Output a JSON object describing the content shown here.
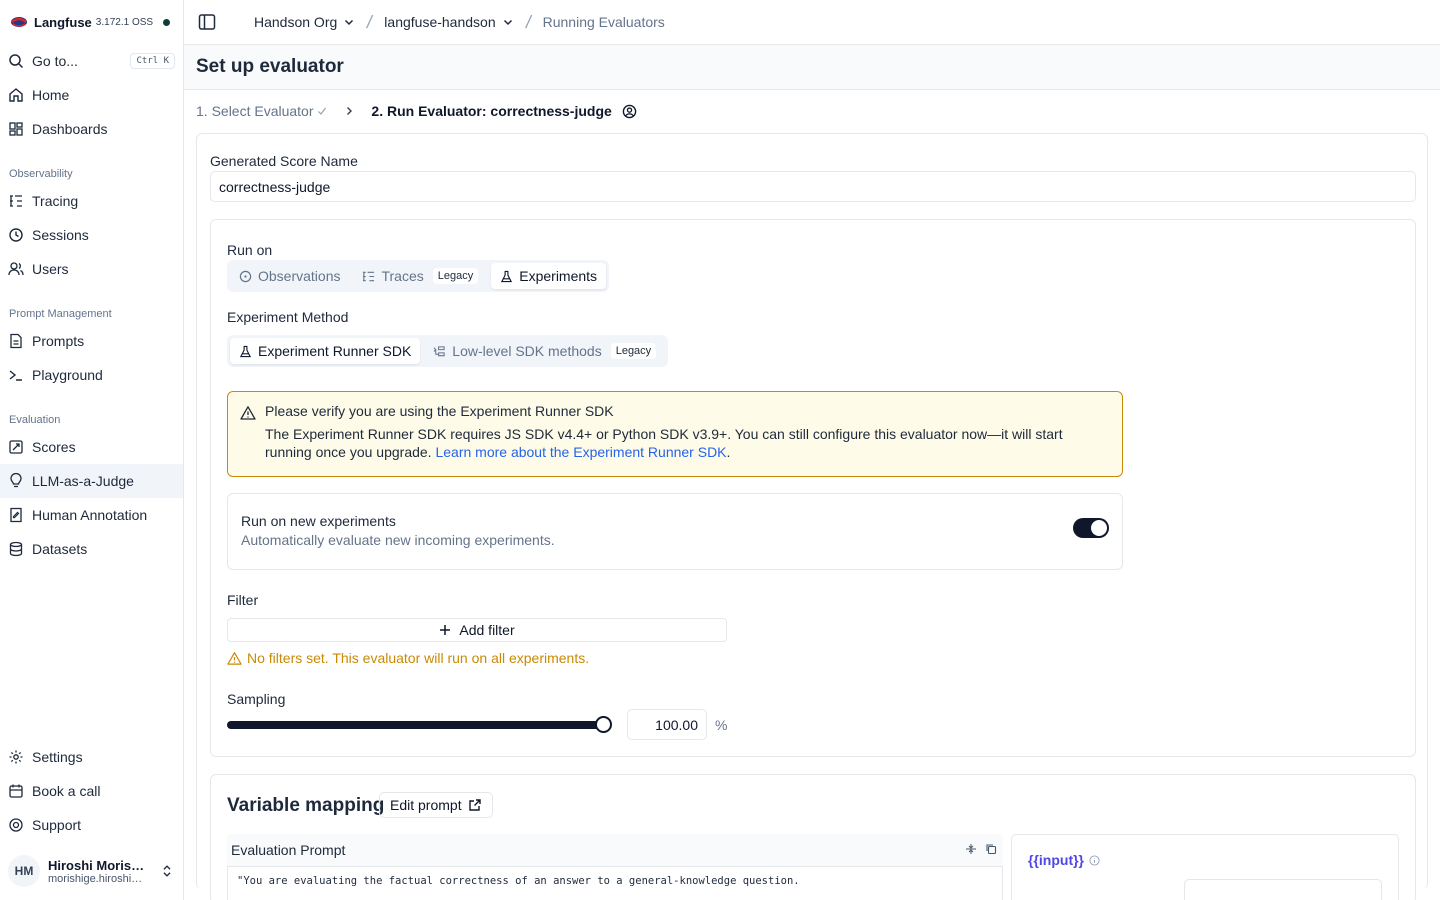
{
  "brand": {
    "name": "Langfuse",
    "version": "3.172.1 OSS"
  },
  "sidebar": {
    "goto_label": "Go to...",
    "goto_shortcut": "Ctrl K",
    "items_top": [
      {
        "label": "Home",
        "icon": "home-icon"
      },
      {
        "label": "Dashboards",
        "icon": "dashboard-icon"
      }
    ],
    "groups": [
      {
        "title": "Observability",
        "items": [
          {
            "label": "Tracing",
            "icon": "tracing-icon"
          },
          {
            "label": "Sessions",
            "icon": "clock-icon"
          },
          {
            "label": "Users",
            "icon": "users-icon"
          }
        ]
      },
      {
        "title": "Prompt Management",
        "items": [
          {
            "label": "Prompts",
            "icon": "file-icon"
          },
          {
            "label": "Playground",
            "icon": "terminal-icon"
          }
        ]
      },
      {
        "title": "Evaluation",
        "items": [
          {
            "label": "Scores",
            "icon": "scores-icon"
          },
          {
            "label": "LLM-as-a-Judge",
            "icon": "lightbulb-icon",
            "active": true
          },
          {
            "label": "Human Annotation",
            "icon": "annotation-icon"
          },
          {
            "label": "Datasets",
            "icon": "database-icon"
          }
        ]
      }
    ],
    "bottom": [
      {
        "label": "Settings",
        "icon": "gear-icon"
      },
      {
        "label": "Book a call",
        "icon": "calendar-icon"
      },
      {
        "label": "Support",
        "icon": "support-icon"
      }
    ],
    "user": {
      "initials": "HM",
      "name": "Hiroshi Morishige",
      "email": "morishige.hiroshi@example.com"
    }
  },
  "topbar": {
    "org": "Handson Org",
    "project": "langfuse-handson",
    "page": "Running Evaluators"
  },
  "page": {
    "title": "Set up evaluator",
    "step1": "1. Select Evaluator",
    "step2": "2. Run Evaluator: correctness-judge"
  },
  "form": {
    "score_name_label": "Generated Score Name",
    "score_name_value": "correctness-judge",
    "run_on_label": "Run on",
    "run_on_options": [
      "Observations",
      "Traces",
      "Experiments"
    ],
    "legacy_badge": "Legacy",
    "method_label": "Experiment Method",
    "method_options": [
      "Experiment Runner SDK",
      "Low-level SDK methods"
    ],
    "alert_title": "Please verify you are using the Experiment Runner SDK",
    "alert_body": "The Experiment Runner SDK requires JS SDK v4.4+ or Python SDK v3.9+. You can still configure this evaluator now—it will start running once you upgrade. ",
    "alert_link": "Learn more about the Experiment Runner SDK",
    "alert_tail": ".",
    "toggle_title": "Run on new experiments",
    "toggle_sub": "Automatically evaluate new incoming experiments.",
    "toggle_on": true,
    "filter_label": "Filter",
    "add_filter": "Add filter",
    "filter_warning": "No filters set. This evaluator will run on all experiments.",
    "sampling_label": "Sampling",
    "sampling_value": "100.00",
    "sampling_fraction": 1.0,
    "sampling_unit": "%"
  },
  "variables": {
    "title": "Variable mapping",
    "edit_prompt": "Edit prompt",
    "prompt_title": "Evaluation Prompt",
    "prompt_text": "\"You are evaluating the factual correctness of an answer to a general-knowledge question.",
    "var_name": "{{input}}"
  },
  "colors": {
    "accent": "#0f172a",
    "warning": "#ca8a04",
    "link": "#2563eb",
    "variable": "#4f46e5"
  }
}
